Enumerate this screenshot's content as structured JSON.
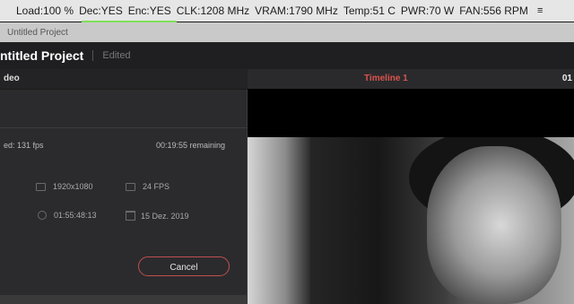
{
  "menubar": {
    "load": "Load:100 %",
    "dec": "Dec:YES",
    "enc": "Enc:YES",
    "clk": "CLK:1208 MHz",
    "vram": "VRAM:1790 MHz",
    "temp": "Temp:51 C",
    "pwr": "PWR:70 W",
    "fan": "FAN:556 RPM",
    "extra": "≡"
  },
  "tabbar": {
    "title": "Untitled Project"
  },
  "header": {
    "project_title": "ntitled Project",
    "edited": "Edited"
  },
  "viewer": {
    "timeline": "Timeline 1",
    "timecode": "01"
  },
  "dialog": {
    "title": "deo",
    "speed": "ed: 131 fps",
    "remaining": "00:19:55 remaining",
    "resolution": "1920x1080",
    "fps": "24 FPS",
    "duration": "01:55:48:13",
    "date": "15 Dez. 2019",
    "cancel_label": "Cancel"
  },
  "colors": {
    "accent_red": "#d9534f",
    "load_indicator": "#7ee05a"
  }
}
